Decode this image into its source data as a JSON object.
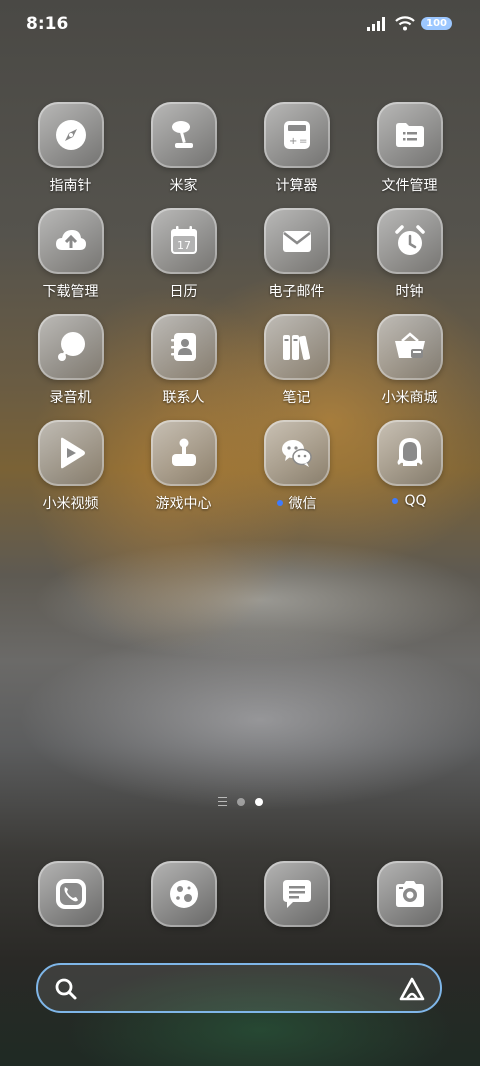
{
  "status_bar": {
    "time": "8:16",
    "battery": "100"
  },
  "apps": [
    {
      "label": "指南针",
      "icon": "compass-icon",
      "dot": false
    },
    {
      "label": "米家",
      "icon": "mijia-lamp-icon",
      "dot": false
    },
    {
      "label": "计算器",
      "icon": "calculator-icon",
      "dot": false
    },
    {
      "label": "文件管理",
      "icon": "folder-icon",
      "dot": false
    },
    {
      "label": "下载管理",
      "icon": "cloud-download-icon",
      "dot": false
    },
    {
      "label": "日历",
      "icon": "calendar-icon",
      "day": "17",
      "dot": false
    },
    {
      "label": "电子邮件",
      "icon": "mail-icon",
      "dot": false
    },
    {
      "label": "时钟",
      "icon": "alarm-clock-icon",
      "dot": false
    },
    {
      "label": "录音机",
      "icon": "recorder-icon",
      "dot": false
    },
    {
      "label": "联系人",
      "icon": "contacts-icon",
      "dot": false
    },
    {
      "label": "笔记",
      "icon": "notes-icon",
      "dot": false
    },
    {
      "label": "小米商城",
      "icon": "shopping-basket-icon",
      "dot": false
    },
    {
      "label": "小米视频",
      "icon": "video-play-icon",
      "dot": false
    },
    {
      "label": "游戏中心",
      "icon": "joystick-icon",
      "dot": false
    },
    {
      "label": "微信",
      "icon": "wechat-icon",
      "dot": true
    },
    {
      "label": "QQ",
      "icon": "qq-penguin-icon",
      "dot": true
    }
  ],
  "dock": [
    {
      "icon": "phone-icon"
    },
    {
      "icon": "browser-planet-icon"
    },
    {
      "icon": "message-icon"
    },
    {
      "icon": "camera-icon"
    }
  ],
  "accent": {
    "notification_dot": "#3d7bff",
    "search_border": "#7fb6e8"
  }
}
